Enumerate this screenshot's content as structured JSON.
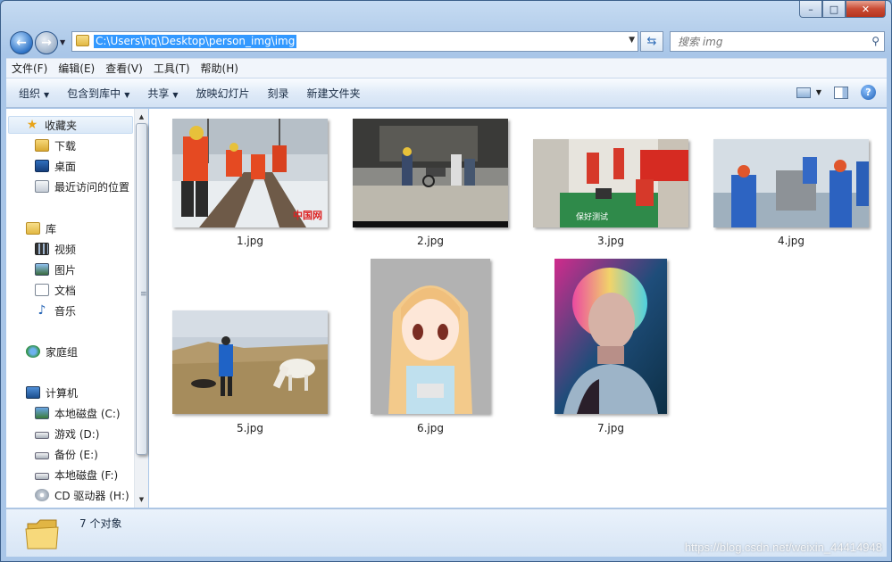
{
  "window": {
    "minimize_glyph": "–",
    "maximize_glyph": "□",
    "close_glyph": "✕"
  },
  "address": {
    "path": "C:\\Users\\hq\\Desktop\\person_img\\img",
    "refresh_glyph": "⇆"
  },
  "search": {
    "placeholder": "搜索 img",
    "icon": "search-icon"
  },
  "menu": [
    "文件(F)",
    "编辑(E)",
    "查看(V)",
    "工具(T)",
    "帮助(H)"
  ],
  "toolbar": {
    "organize": "组织",
    "include_library": "包含到库中",
    "share": "共享",
    "slideshow": "放映幻灯片",
    "burn": "刻录",
    "new_folder": "新建文件夹",
    "help_glyph": "?"
  },
  "sidebar": {
    "favorites": "收藏夹",
    "downloads": "下载",
    "desktop": "桌面",
    "recent": "最近访问的位置",
    "libraries": "库",
    "videos": "视频",
    "pictures": "图片",
    "documents": "文档",
    "music": "音乐",
    "homegroup": "家庭组",
    "computer": "计算机",
    "drives": [
      "本地磁盘 (C:)",
      "游戏 (D:)",
      "备份 (E:)",
      "本地磁盘 (F:)",
      "CD 驱动器 (H:)"
    ]
  },
  "files": [
    "1.jpg",
    "2.jpg",
    "3.jpg",
    "4.jpg",
    "5.jpg",
    "6.jpg",
    "7.jpg"
  ],
  "status": {
    "count": "7 个对象"
  },
  "watermark": "https://blog.csdn.net/weixin_44414948",
  "colors": {
    "selection": "#3399ff",
    "window_frame": "#b7d0ec",
    "status_bar": "#d7e5f5"
  }
}
